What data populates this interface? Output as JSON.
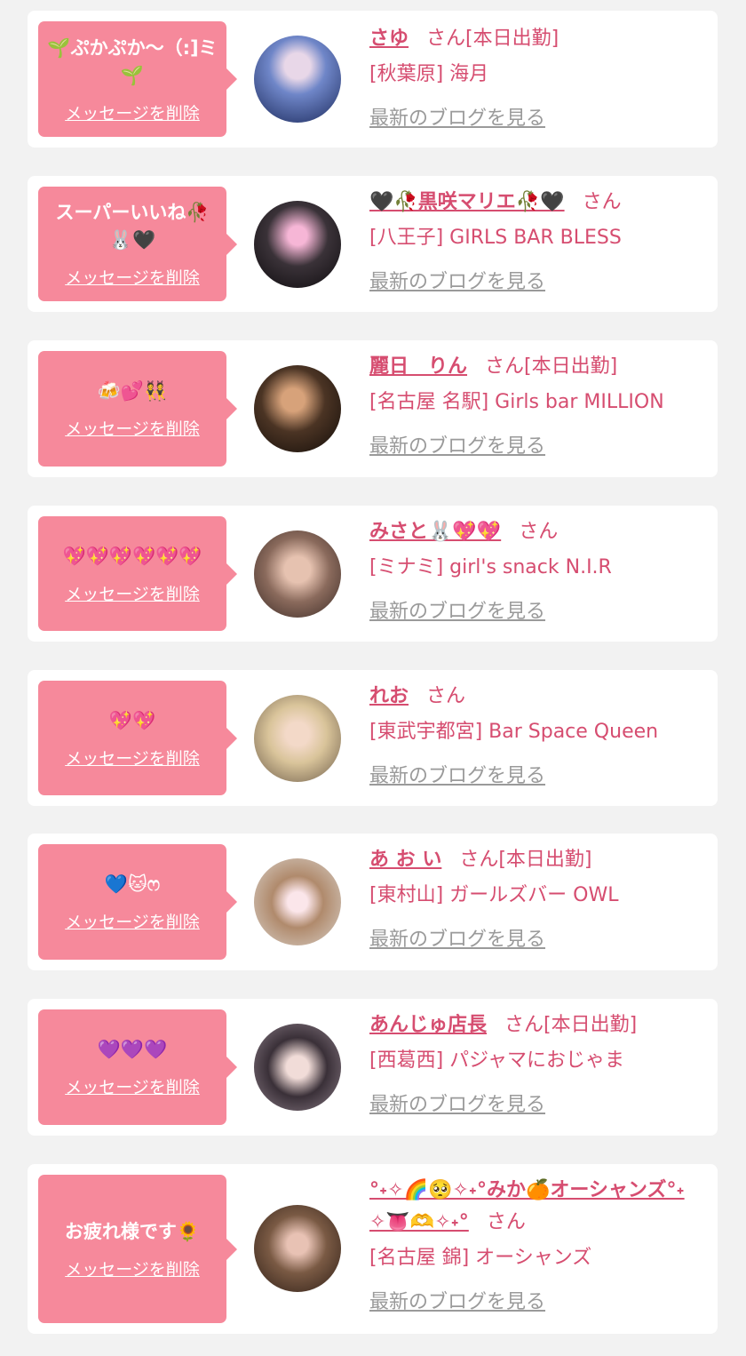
{
  "delete_label": "メッセージを削除",
  "blog_label": "最新のブログを見る",
  "colors": {
    "accent": "#d64d70",
    "bubble": "#f6899b",
    "background": "#f2f2f2"
  },
  "entries": [
    {
      "message": "🌱ぷかぷか〜（:]ミ🌱",
      "name": "さゆ",
      "suffix": "さん[本日出勤]",
      "shop": "[秋葉原] 海月"
    },
    {
      "message": "スーパーいいね🥀🐰🖤",
      "name": "🖤🥀黒咲マリエ🥀🖤",
      "suffix": "さん",
      "shop": "[八王子] GIRLS BAR BLESS"
    },
    {
      "message": "🍻💕👯",
      "name": "麗日　りん",
      "suffix": "さん[本日出勤]",
      "shop": "[名古屋 名駅] Girls bar MILLION"
    },
    {
      "message": "💖💖💖💖💖💖",
      "name": "みさと🐰💖💖",
      "suffix": "さん",
      "shop": "[ミナミ] girl's snack N.I.R"
    },
    {
      "message": "💖💖",
      "name": "れお",
      "suffix": "さん",
      "shop": "[東武宇都宮] Bar Space Queen"
    },
    {
      "message": "💙🐱ෆ",
      "name": "あ お い",
      "suffix": "さん[本日出勤]",
      "shop": "[東村山] ガールズバー OWL"
    },
    {
      "message": "💜💜💜",
      "name": "あんじゅ店長",
      "suffix": "さん[本日出勤]",
      "shop": "[西葛西] パジャマにおじゃま"
    },
    {
      "message": "お疲れ様です🌻",
      "name": "°˖✧🌈🥺✧˖°みか🍊オーシャンズ°˖✧👅🫶✧˖°",
      "suffix": "さん",
      "shop": "[名古屋 錦] オーシャンズ"
    }
  ]
}
